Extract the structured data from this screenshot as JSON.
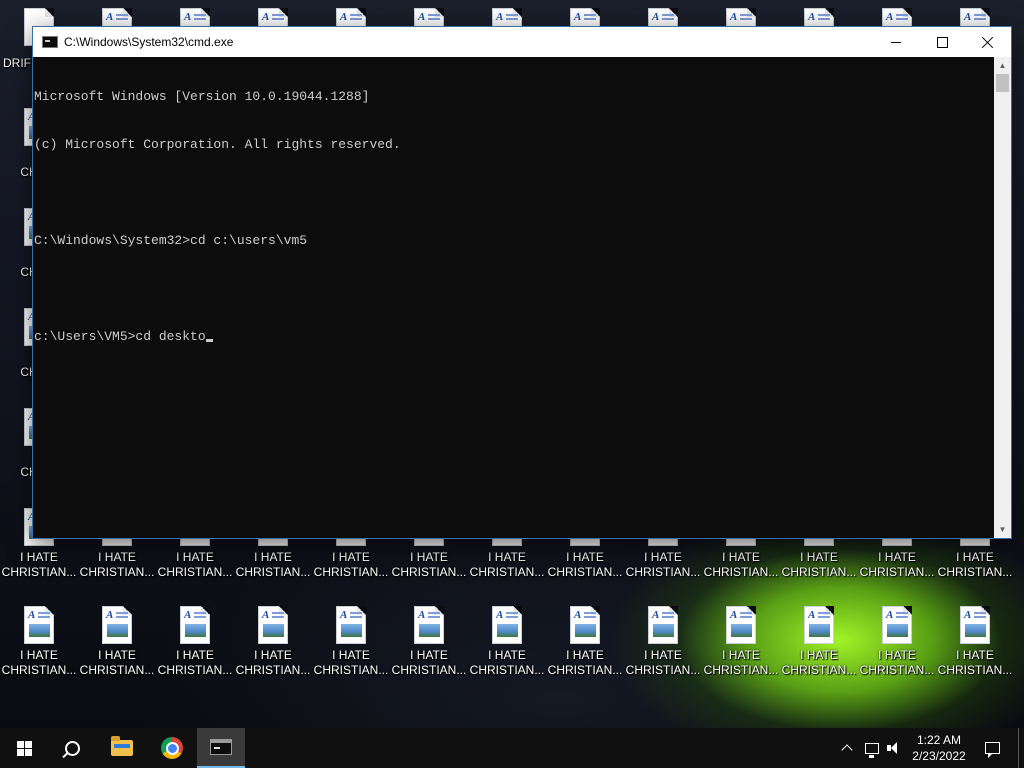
{
  "window": {
    "title": "C:\\Windows\\System32\\cmd.exe",
    "buttons": {
      "minimize": "minimize",
      "maximize": "maximize",
      "close": "close"
    }
  },
  "console": {
    "lines": [
      "Microsoft Windows [Version 10.0.19044.1288]",
      "(c) Microsoft Corporation. All rights reserved.",
      "",
      "C:\\Windows\\System32>cd c:\\users\\vm5",
      "",
      "c:\\Users\\VM5>cd deskto"
    ]
  },
  "desktop": {
    "top_left_icon_label": "DRIFE CHRIS",
    "icon_label_line1": "I HATE",
    "icon_label_line2": "CHRISTIAN...",
    "left_column_label_line1": "I H",
    "left_column_label_line2": "CHRIS"
  },
  "taskbar": {
    "apps": [
      "start-icon",
      "search-icon",
      "file-explorer-icon",
      "chrome-icon",
      "command-prompt-icon"
    ],
    "clock": {
      "time": "1:22 AM",
      "date": "2/23/2022"
    }
  }
}
